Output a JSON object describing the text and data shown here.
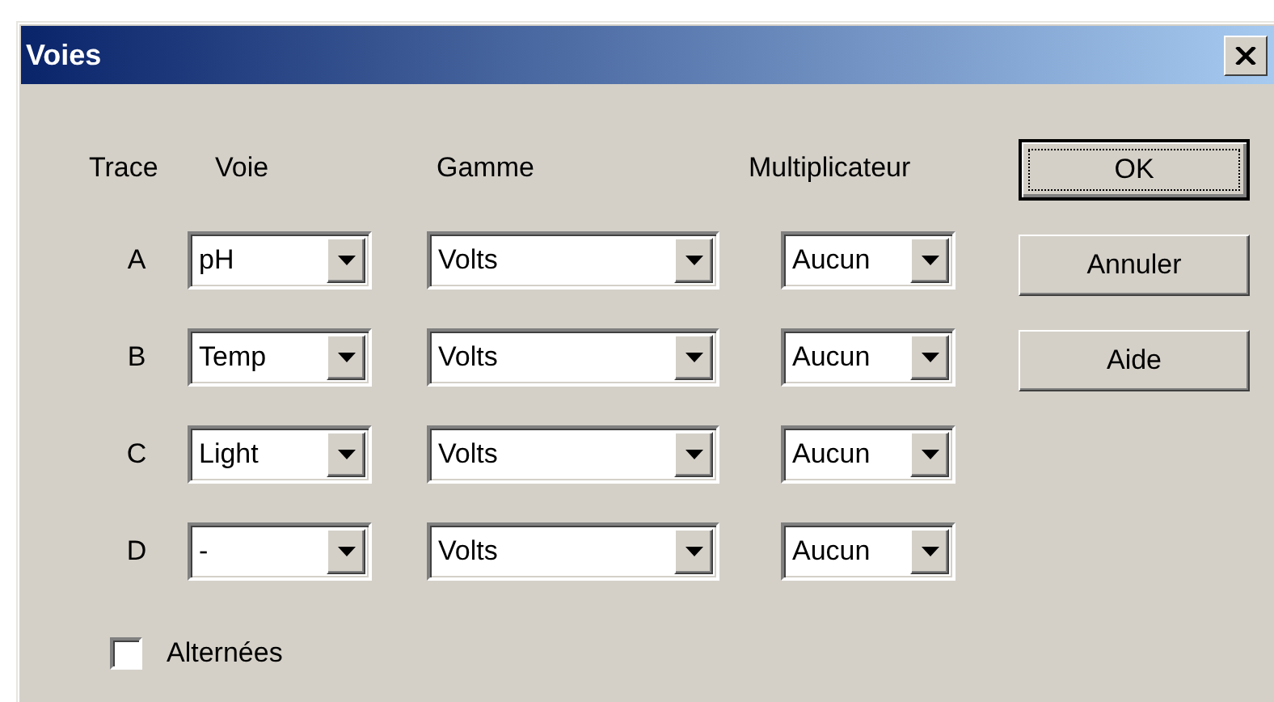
{
  "window": {
    "title": "Voies"
  },
  "column_headers": [
    "Trace",
    "Voie",
    "Gamme",
    "Multiplicateur"
  ],
  "rows": [
    {
      "trace": "A",
      "voie": "pH",
      "gamme": "Volts",
      "multiplicateur": "Aucun"
    },
    {
      "trace": "B",
      "voie": "Temp",
      "gamme": "Volts",
      "multiplicateur": "Aucun"
    },
    {
      "trace": "C",
      "voie": "Light",
      "gamme": "Volts",
      "multiplicateur": "Aucun"
    },
    {
      "trace": "D",
      "voie": "-",
      "gamme": "Volts",
      "multiplicateur": "Aucun"
    }
  ],
  "checkbox": {
    "label": "Alternées",
    "checked": false
  },
  "buttons": [
    {
      "label": "OK",
      "default": true
    },
    {
      "label": "Annuler",
      "default": false
    },
    {
      "label": "Aide",
      "default": false
    }
  ]
}
